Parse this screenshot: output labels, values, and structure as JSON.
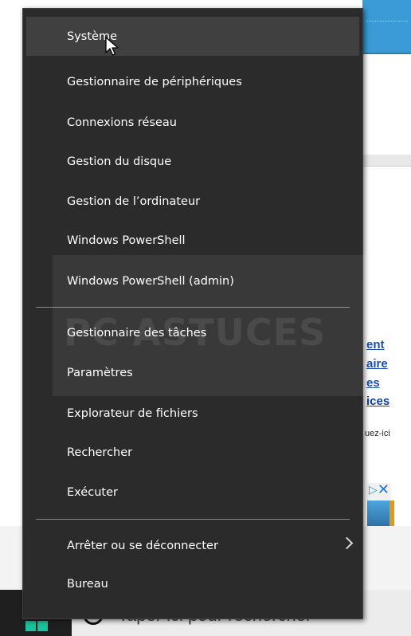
{
  "menu": {
    "items": [
      {
        "label": "Système"
      },
      {
        "label": "Gestionnaire de périphériques"
      },
      {
        "label": "Connexions réseau"
      },
      {
        "label": "Gestion du disque"
      },
      {
        "label": "Gestion de l’ordinateur"
      },
      {
        "label": "Windows PowerShell"
      },
      {
        "label": "Windows PowerShell (admin)"
      },
      {
        "label": "Gestionnaire des tâches"
      },
      {
        "label": "Paramètres"
      },
      {
        "label": "Explorateur de fichiers"
      },
      {
        "label": "Rechercher"
      },
      {
        "label": "Exécuter"
      },
      {
        "label": "Arrêter ou se déconnecter"
      },
      {
        "label": "Bureau"
      }
    ],
    "hovered_index": 0
  },
  "background": {
    "links": [
      "ent",
      "aire",
      "es",
      "ices"
    ],
    "small_text": "uez-ici"
  },
  "watermark": {
    "text": "PC ASTUCES"
  },
  "taskbar": {
    "search_placeholder": "Taper ici pour rechercher",
    "start_icon": "windows-logo-icon",
    "search_icon": "cortana-circle-icon"
  },
  "colors": {
    "menu_bg": "#2b2b2b",
    "hover_bg": "#404040",
    "accent_blue": "#3b9bd6",
    "link_blue": "#0a3fa8"
  }
}
